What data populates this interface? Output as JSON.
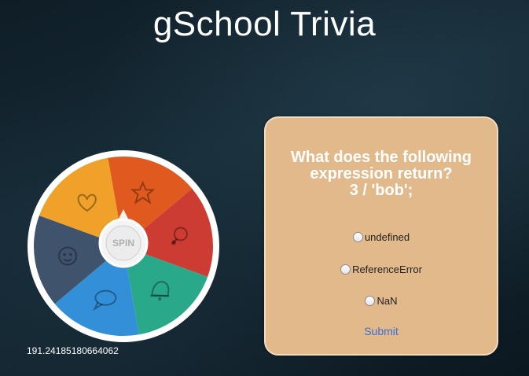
{
  "app": {
    "title": "gSchool Trivia"
  },
  "wheel": {
    "spin_label": "SPIN",
    "rotation_readout": "191.24185180664062",
    "segments": [
      {
        "icon": "star-icon",
        "color": "#e05a1f"
      },
      {
        "icon": "lightbulb-icon",
        "color": "#cd3c33"
      },
      {
        "icon": "bell-icon",
        "color": "#2aa88a"
      },
      {
        "icon": "speech-bubble-icon",
        "color": "#3390d8"
      },
      {
        "icon": "face-icon",
        "color": "#3f546c"
      },
      {
        "icon": "heart-icon",
        "color": "#f0a12a"
      }
    ]
  },
  "question": {
    "line1": "What does the following",
    "line2": "expression return?",
    "line3": "3 / 'bob';"
  },
  "answers": [
    {
      "label": "undefined"
    },
    {
      "label": "ReferenceError"
    },
    {
      "label": "NaN"
    }
  ],
  "submit_label": "Submit"
}
